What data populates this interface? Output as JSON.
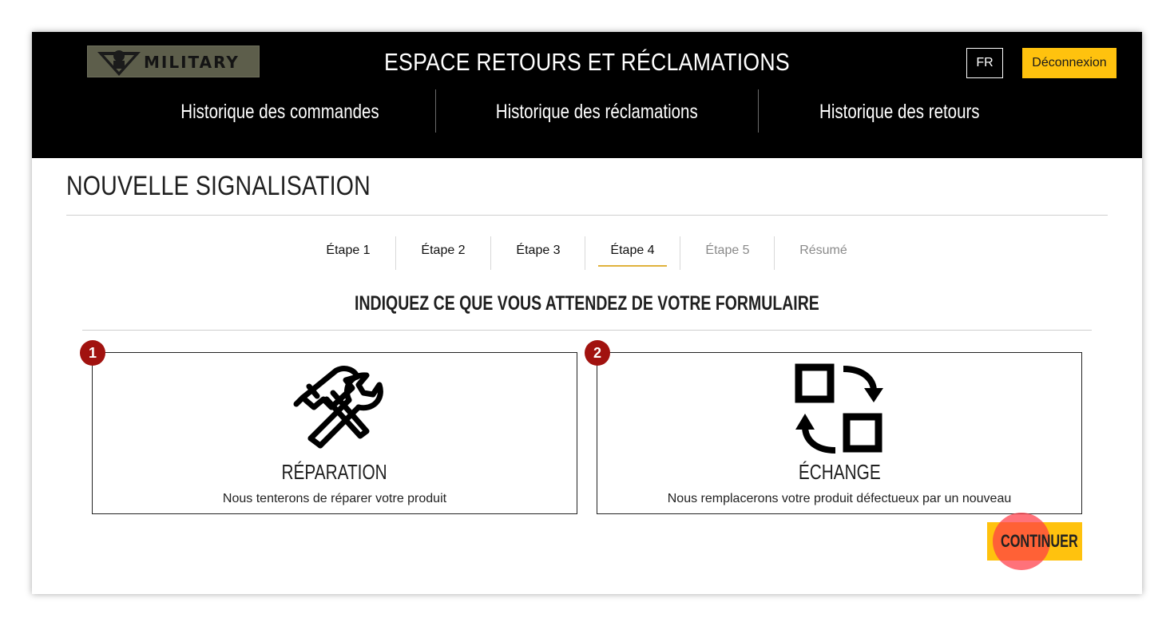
{
  "header": {
    "logo_text": "MILITARY",
    "title": "ESPACE RETOURS ET RÉCLAMATIONS",
    "language": "FR",
    "logout_label": "Déconnexion",
    "nav": [
      {
        "label": "Historique des commandes"
      },
      {
        "label": "Historique des réclamations"
      },
      {
        "label": "Historique des retours"
      }
    ]
  },
  "main": {
    "page_title": "NOUVELLE SIGNALISATION",
    "steps": [
      {
        "label": "Étape 1",
        "state": "done"
      },
      {
        "label": "Étape 2",
        "state": "done"
      },
      {
        "label": "Étape 3",
        "state": "done"
      },
      {
        "label": "Étape 4",
        "state": "active"
      },
      {
        "label": "Étape 5",
        "state": "disabled"
      },
      {
        "label": "Résumé",
        "state": "disabled"
      }
    ],
    "section_title": "INDIQUEZ CE QUE VOUS ATTENDEZ DE VOTRE FORMULAIRE",
    "options": [
      {
        "number": "1",
        "title": "RÉPARATION",
        "description": "Nous tenterons de réparer votre produit",
        "icon": "tools-icon"
      },
      {
        "number": "2",
        "title": "ÉCHANGE",
        "description": "Nous remplacerons votre produit défectueux par un nouveau",
        "icon": "exchange-icon"
      }
    ],
    "continue_label": "CONTINUER"
  },
  "colors": {
    "header_bg": "#000000",
    "accent": "#ffc20e",
    "badge": "#a1120f",
    "active_step_underline": "#e0b23c"
  }
}
